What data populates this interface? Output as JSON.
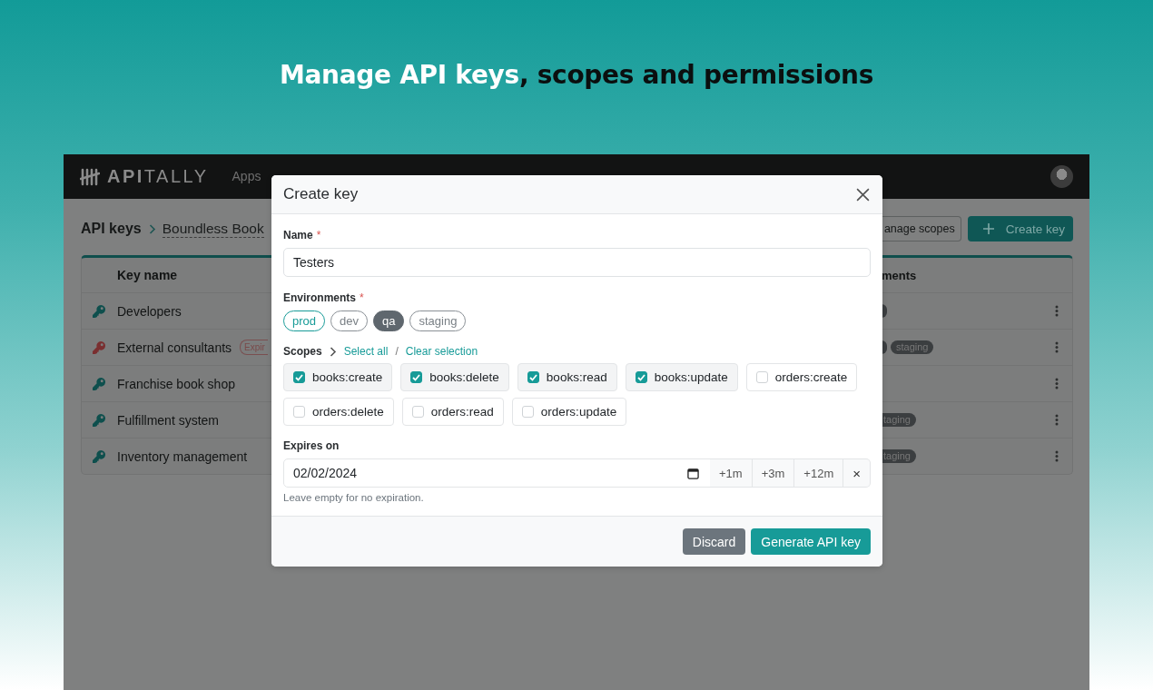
{
  "headline": {
    "highlight": "Manage API keys",
    "rest": ", scopes and permissions"
  },
  "app": {
    "logo": "**API**TALLY",
    "nav": [
      "Apps"
    ],
    "breadcrumb": {
      "root": "API keys",
      "current": "Boundless Book"
    },
    "buttons": {
      "manage": "anage scopes",
      "create": "Create key"
    },
    "table": {
      "columns": [
        "Key name",
        "ments"
      ],
      "rows": [
        {
          "name": "Developers",
          "expired": false,
          "chips": [
            {
              "kind": "fragment"
            }
          ]
        },
        {
          "name": "External consultants",
          "expired": true,
          "badge": "Expir",
          "chips": [
            {
              "kind": "fragment"
            },
            {
              "kind": "label",
              "label": "staging"
            }
          ]
        },
        {
          "name": "Franchise book shop",
          "expired": false,
          "chips": []
        },
        {
          "name": "Fulfillment system",
          "expired": false,
          "chips": [
            {
              "kind": "cut",
              "label": "taging"
            }
          ]
        },
        {
          "name": "Inventory management",
          "expired": false,
          "chips": [
            {
              "kind": "cut",
              "label": "taging"
            }
          ]
        }
      ]
    }
  },
  "modal": {
    "title": "Create key",
    "name": {
      "label": "Name",
      "required_mark": "*",
      "value": "Testers"
    },
    "environments": {
      "label": "Environments",
      "required_mark": "*",
      "items": [
        {
          "label": "prod",
          "selected": true,
          "disabled": false
        },
        {
          "label": "dev",
          "selected": false,
          "disabled": false
        },
        {
          "label": "qa",
          "selected": false,
          "disabled": true
        },
        {
          "label": "staging",
          "selected": false,
          "disabled": false
        }
      ]
    },
    "scopes": {
      "label": "Scopes",
      "select_all": "Select all",
      "separator": "/",
      "clear": "Clear selection",
      "items": [
        {
          "label": "books:create",
          "checked": true
        },
        {
          "label": "books:delete",
          "checked": true
        },
        {
          "label": "books:read",
          "checked": true
        },
        {
          "label": "books:update",
          "checked": true
        },
        {
          "label": "orders:create",
          "checked": false
        },
        {
          "label": "orders:delete",
          "checked": false
        },
        {
          "label": "orders:read",
          "checked": false
        },
        {
          "label": "orders:update",
          "checked": false
        }
      ]
    },
    "expires": {
      "label": "Expires on",
      "value": "02/02/2024",
      "shortcuts": [
        "+1m",
        "+3m",
        "+12m"
      ],
      "clear": "×",
      "hint": "Leave empty for no expiration."
    },
    "footer": {
      "discard": "Discard",
      "generate": "Generate API key"
    }
  }
}
